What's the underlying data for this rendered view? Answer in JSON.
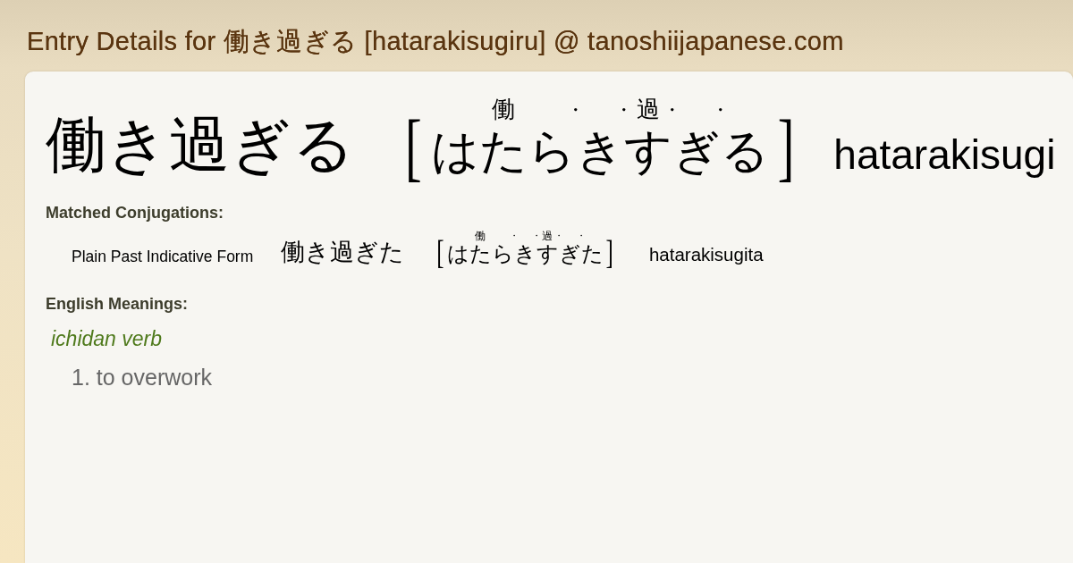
{
  "page_title": "Entry Details for 働き過ぎる [hatarakisugiru] @ tanoshiijapanese.com",
  "entry": {
    "word": "働き過ぎる",
    "reading": {
      "open_bracket": "[",
      "segments": [
        {
          "kana": "はたら",
          "ruby": "働",
          "boundary_mark": "・"
        },
        {
          "kana": "き",
          "boundary_mark": "・"
        },
        {
          "kana": "す",
          "ruby": "過",
          "boundary_mark": "・"
        },
        {
          "kana": "ぎ",
          "boundary_mark": "・"
        },
        {
          "kana": "る"
        }
      ],
      "close_bracket": "]"
    },
    "romaji": "hatarakisugi"
  },
  "conjugations": {
    "heading": "Matched Conjugations:",
    "items": [
      {
        "form": "Plain Past Indicative Form",
        "word": "働き過ぎた",
        "reading": {
          "open_bracket": "[",
          "segments": [
            {
              "kana": "はたら",
              "ruby": "働",
              "boundary_mark": "・"
            },
            {
              "kana": "き",
              "boundary_mark": "・"
            },
            {
              "kana": "す",
              "ruby": "過",
              "boundary_mark": "・"
            },
            {
              "kana": "ぎ",
              "boundary_mark": "・"
            },
            {
              "kana": "た"
            }
          ],
          "close_bracket": "]"
        },
        "romaji": "hatarakisugita"
      }
    ]
  },
  "meanings": {
    "heading": "English Meanings:",
    "groups": [
      {
        "part_of_speech": "ichidan verb",
        "senses": [
          "1. to overwork"
        ]
      }
    ]
  }
}
